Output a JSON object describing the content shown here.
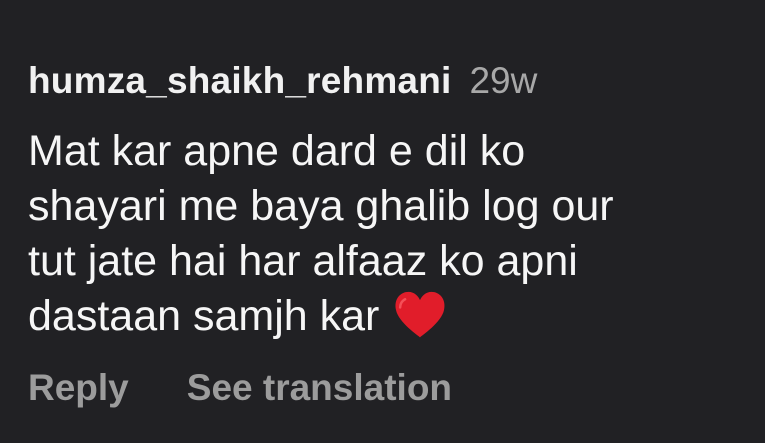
{
  "comment": {
    "username": "humza_shaikh_rehmani",
    "timestamp": "29w",
    "text": "Mat kar apne dard e dil ko\nshayari me baya ghalib log our\ntut jate hai har alfaaz ko apni\ndastaan samjh kar",
    "emoji": "red-heart",
    "actions": {
      "reply": "Reply",
      "see_translation": "See translation"
    }
  },
  "colors": {
    "background": "#212124",
    "text_primary": "#f5f5f5",
    "text_secondary": "#a8a8a8",
    "heart": "#e11d2a"
  }
}
